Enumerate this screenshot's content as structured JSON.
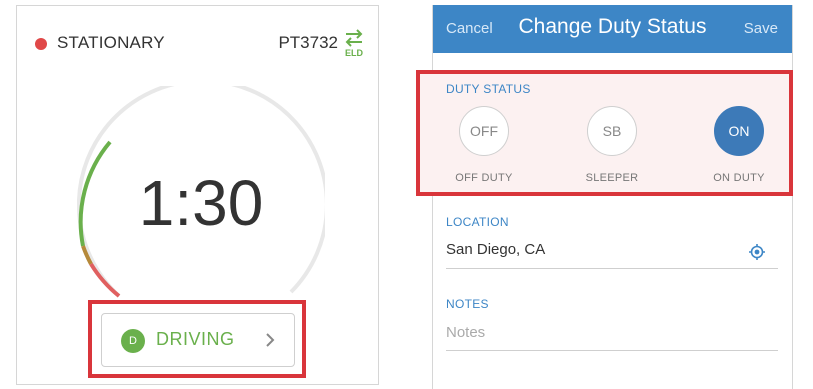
{
  "left": {
    "status_text": "STATIONARY",
    "status_color": "#e04848",
    "unit_id": "PT3732",
    "eld_icon": "swap-arrows-icon",
    "eld_label": "ELD",
    "timer": "1:30",
    "driving": {
      "badge": "D",
      "label": "DRIVING",
      "chevron_icon": "chevron-right-icon"
    }
  },
  "right": {
    "topbar": {
      "cancel": "Cancel",
      "title": "Change Duty Status",
      "save": "Save"
    },
    "duty_status": {
      "label": "DUTY STATUS",
      "options": [
        {
          "code": "OFF",
          "label": "OFF DUTY",
          "selected": false
        },
        {
          "code": "SB",
          "label": "SLEEPER",
          "selected": false
        },
        {
          "code": "ON",
          "label": "ON DUTY",
          "selected": true
        }
      ]
    },
    "location": {
      "label": "LOCATION",
      "value": "San Diego, CA",
      "icon": "location-target-icon"
    },
    "notes": {
      "label": "NOTES",
      "placeholder": "Notes"
    }
  },
  "colors": {
    "accent_blue": "#3d86c6",
    "green": "#6ab04c",
    "red": "#e04848",
    "highlight_red": "#d9353b"
  }
}
